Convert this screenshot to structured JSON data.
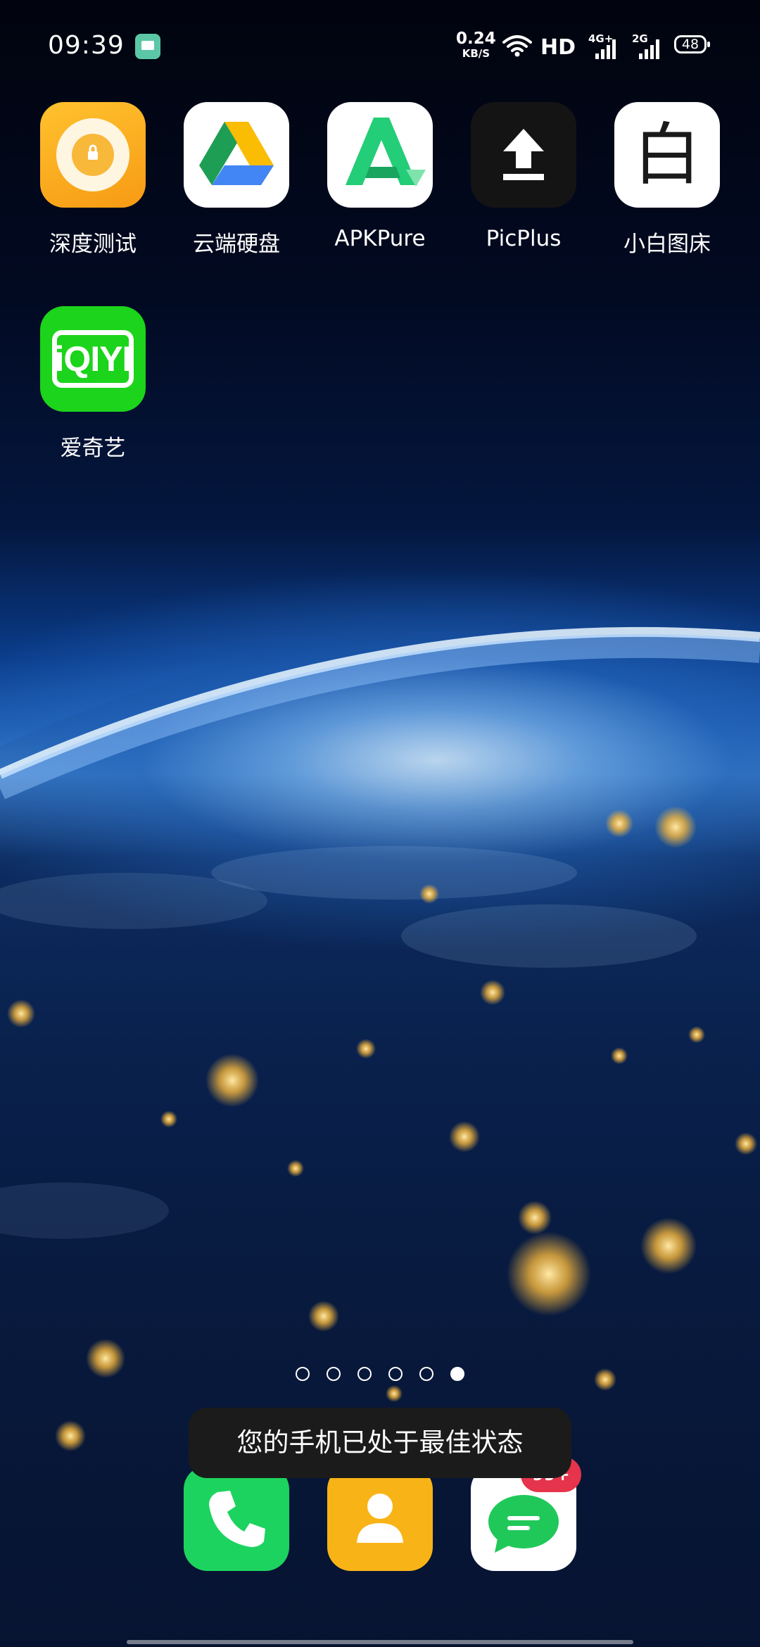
{
  "status_bar": {
    "time": "09:39",
    "net_speed_value": "0.24",
    "net_speed_unit": "KB/S",
    "hd_label": "HD",
    "sim1_label": "4G+",
    "sim2_label": "2G",
    "battery_level": "48"
  },
  "apps": [
    {
      "label": "深度测试",
      "icon": "deep-test-icon",
      "color": "#f7a61c"
    },
    {
      "label": "云端硬盘",
      "icon": "google-drive-icon",
      "color": "#ffffff"
    },
    {
      "label": "APKPure",
      "icon": "apkpure-icon",
      "color": "#ffffff"
    },
    {
      "label": "PicPlus",
      "icon": "picplus-upload-icon",
      "color": "#141414"
    },
    {
      "label": "小白图床",
      "icon": "xiaobai-icon",
      "icon_text": "白",
      "color": "#ffffff"
    },
    {
      "label": "爱奇艺",
      "icon": "iqiyi-icon",
      "icon_text": "iQIYI",
      "color": "#1bd41b"
    }
  ],
  "page_indicator": {
    "total": 6,
    "active": 6
  },
  "toast": {
    "text": "您的手机已处于最佳状态"
  },
  "dock": [
    {
      "name": "phone",
      "icon": "phone-icon",
      "color": "#1dd35f"
    },
    {
      "name": "contacts",
      "icon": "contacts-icon",
      "color": "#f8b316"
    },
    {
      "name": "messages",
      "icon": "messages-icon",
      "color": "#ffffff",
      "badge": "99+"
    }
  ]
}
